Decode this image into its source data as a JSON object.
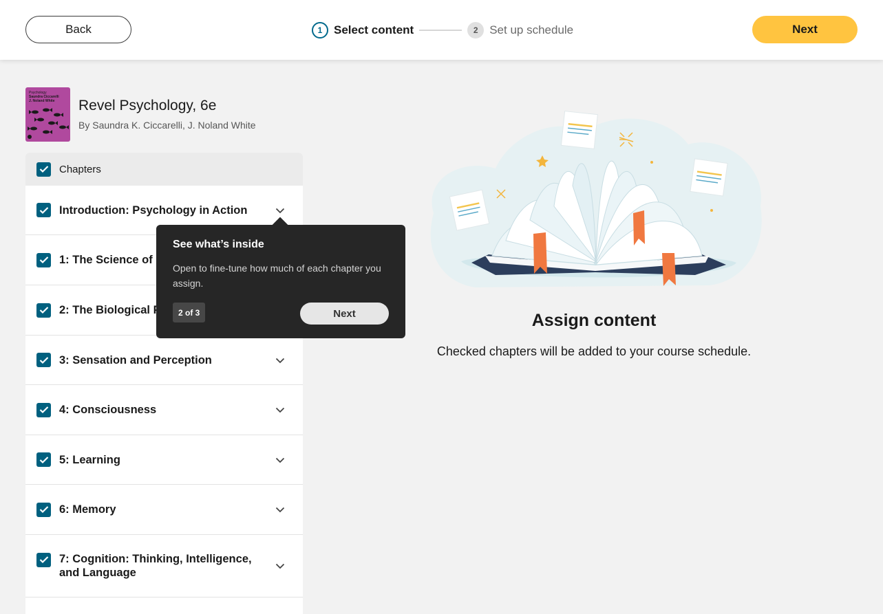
{
  "header": {
    "back_label": "Back",
    "next_label": "Next",
    "steps": [
      {
        "number": "1",
        "label": "Select content",
        "state": "active"
      },
      {
        "number": "2",
        "label": "Set up schedule",
        "state": "inactive"
      }
    ]
  },
  "book": {
    "title": "Revel Psychology, 6e",
    "author": "By Saundra K. Ciccarelli, J. Noland White",
    "cover_text": [
      "Psychology",
      "Saundra Ciccarelli",
      "J. Noland White"
    ],
    "cover_color": "#b0499e"
  },
  "chapters": {
    "header_label": "Chapters",
    "header_checked": true,
    "items": [
      {
        "label": "Introduction: Psychology in Action",
        "checked": true
      },
      {
        "label": "1: The Science of Psychology",
        "checked": true
      },
      {
        "label": "2: The Biological Perspective",
        "checked": true
      },
      {
        "label": "3: Sensation and Perception",
        "checked": true
      },
      {
        "label": "4: Consciousness",
        "checked": true
      },
      {
        "label": "5: Learning",
        "checked": true
      },
      {
        "label": "6: Memory",
        "checked": true
      },
      {
        "label": "7: Cognition: Thinking, Intelligence, and Language",
        "checked": true
      }
    ]
  },
  "tooltip": {
    "title": "See what’s inside",
    "body": "Open to fine-tune how much of each chapter you assign.",
    "counter": "2 of 3",
    "next_label": "Next"
  },
  "main": {
    "title": "Assign content",
    "subtitle": "Checked chapters will be added to your course schedule."
  },
  "colors": {
    "accent": "#00607f",
    "primary_button": "#ffc440",
    "tooltip_bg": "#262626",
    "bookmark": "#f07840"
  }
}
